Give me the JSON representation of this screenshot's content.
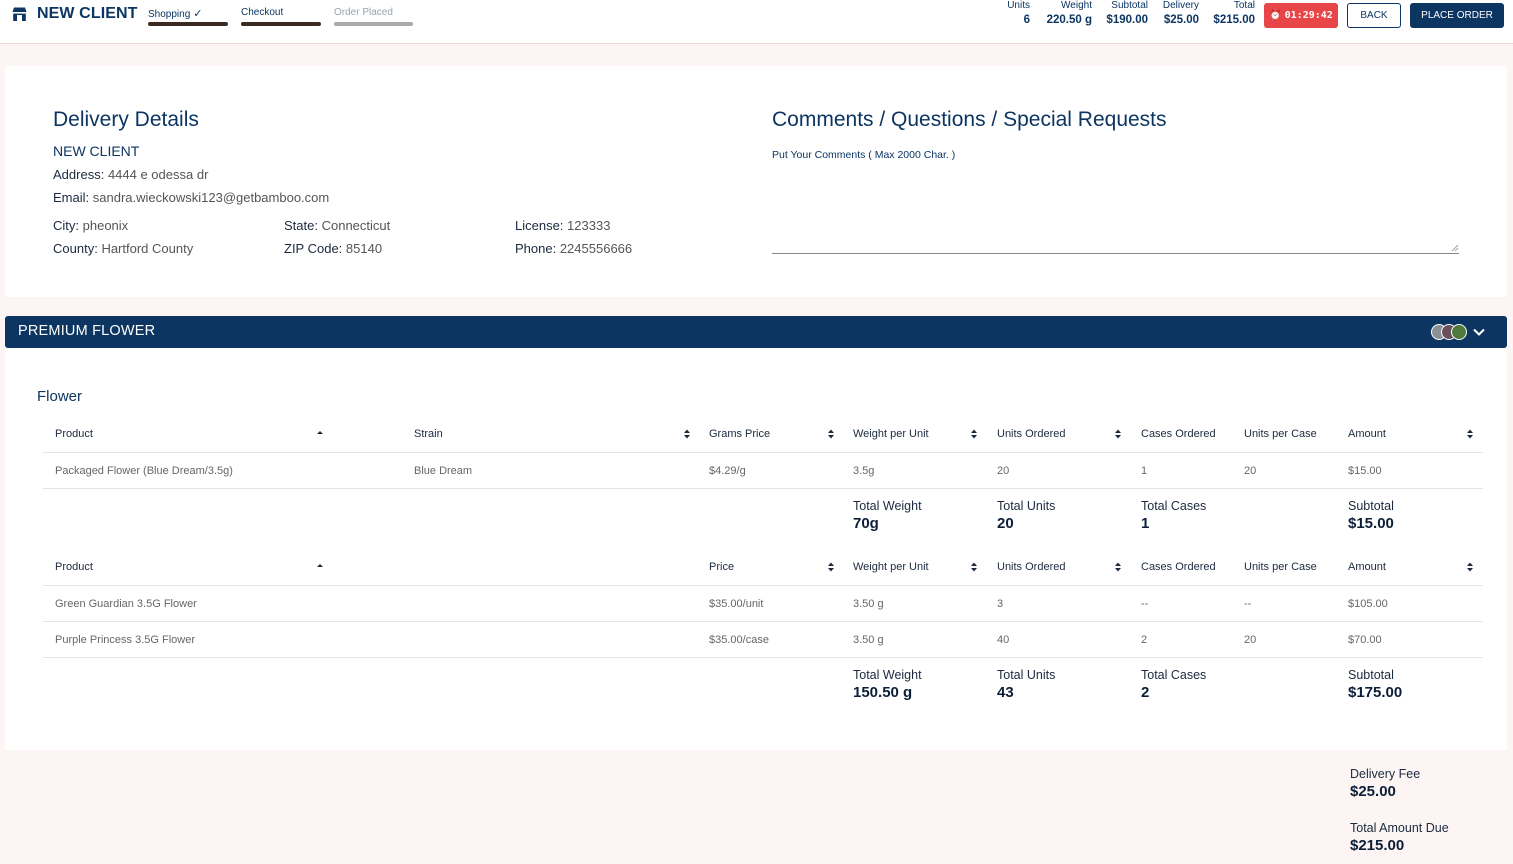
{
  "header": {
    "brand": "NEW CLIENT",
    "steps": [
      {
        "label": "Shopping",
        "done": true
      },
      {
        "label": "Checkout",
        "done": false
      },
      {
        "label": "Order Placed",
        "done": false
      }
    ],
    "stats": [
      {
        "label": "Units",
        "value": "6"
      },
      {
        "label": "Weight",
        "value": "220.50 g"
      },
      {
        "label": "Subtotal",
        "value": "$190.00"
      },
      {
        "label": "Delivery",
        "value": "$25.00"
      },
      {
        "label": "Total",
        "value": "$215.00"
      }
    ],
    "timer": "01:29:42",
    "back_label": "BACK",
    "place_order_label": "PLACE ORDER",
    "colors": {
      "primary": "#0c3562",
      "timer": "#e74548"
    }
  },
  "delivery": {
    "title": "Delivery Details",
    "client": "NEW CLIENT",
    "address_label": "Address:",
    "address": "4444 e odessa dr",
    "email_label": "Email:",
    "email": "sandra.wieckowski123@getbamboo.com",
    "city_label": "City:",
    "city": "pheonix",
    "county_label": "County:",
    "county": "Hartford County",
    "state_label": "State:",
    "state": "Connecticut",
    "zip_label": "ZIP Code:",
    "zip": "85140",
    "license_label": "License:",
    "license": "123333",
    "phone_label": "Phone:",
    "phone": "2245556666"
  },
  "comments": {
    "title": "Comments / Questions / Special Requests",
    "hint": "Put Your Comments ( Max 2000 Char. )",
    "value": ""
  },
  "category": {
    "title": "PREMIUM FLOWER",
    "subcategory": "Flower",
    "table1": {
      "headers": [
        "Product",
        "Strain",
        "Grams Price",
        "Weight per Unit",
        "Units Ordered",
        "Cases Ordered",
        "Units per Case",
        "Amount"
      ],
      "rows": [
        [
          "Packaged Flower (Blue Dream/3.5g)",
          "Blue Dream",
          "$4.29/g",
          "3.5g",
          "20",
          "1",
          "20",
          "$15.00"
        ]
      ],
      "totals": {
        "weight_label": "Total Weight",
        "weight": "70g",
        "units_label": "Total Units",
        "units": "20",
        "cases_label": "Total Cases",
        "cases": "1",
        "subtotal_label": "Subtotal",
        "subtotal": "$15.00"
      }
    },
    "table2": {
      "headers": [
        "Product",
        "Price",
        "Weight per Unit",
        "Units Ordered",
        "Cases Ordered",
        "Units per Case",
        "Amount"
      ],
      "rows": [
        [
          "Green Guardian 3.5G Flower",
          "$35.00/unit",
          "3.50 g",
          "3",
          "--",
          "--",
          "$105.00"
        ],
        [
          "Purple Princess 3.5G Flower",
          "$35.00/case",
          "3.50 g",
          "40",
          "2",
          "20",
          "$70.00"
        ]
      ],
      "totals": {
        "weight_label": "Total Weight",
        "weight": "150.50 g",
        "units_label": "Total Units",
        "units": "43",
        "cases_label": "Total Cases",
        "cases": "2",
        "subtotal_label": "Subtotal",
        "subtotal": "$175.00"
      }
    }
  },
  "footer": {
    "delivery_fee_label": "Delivery Fee",
    "delivery_fee": "$25.00",
    "total_due_label": "Total Amount Due",
    "total_due": "$215.00"
  }
}
